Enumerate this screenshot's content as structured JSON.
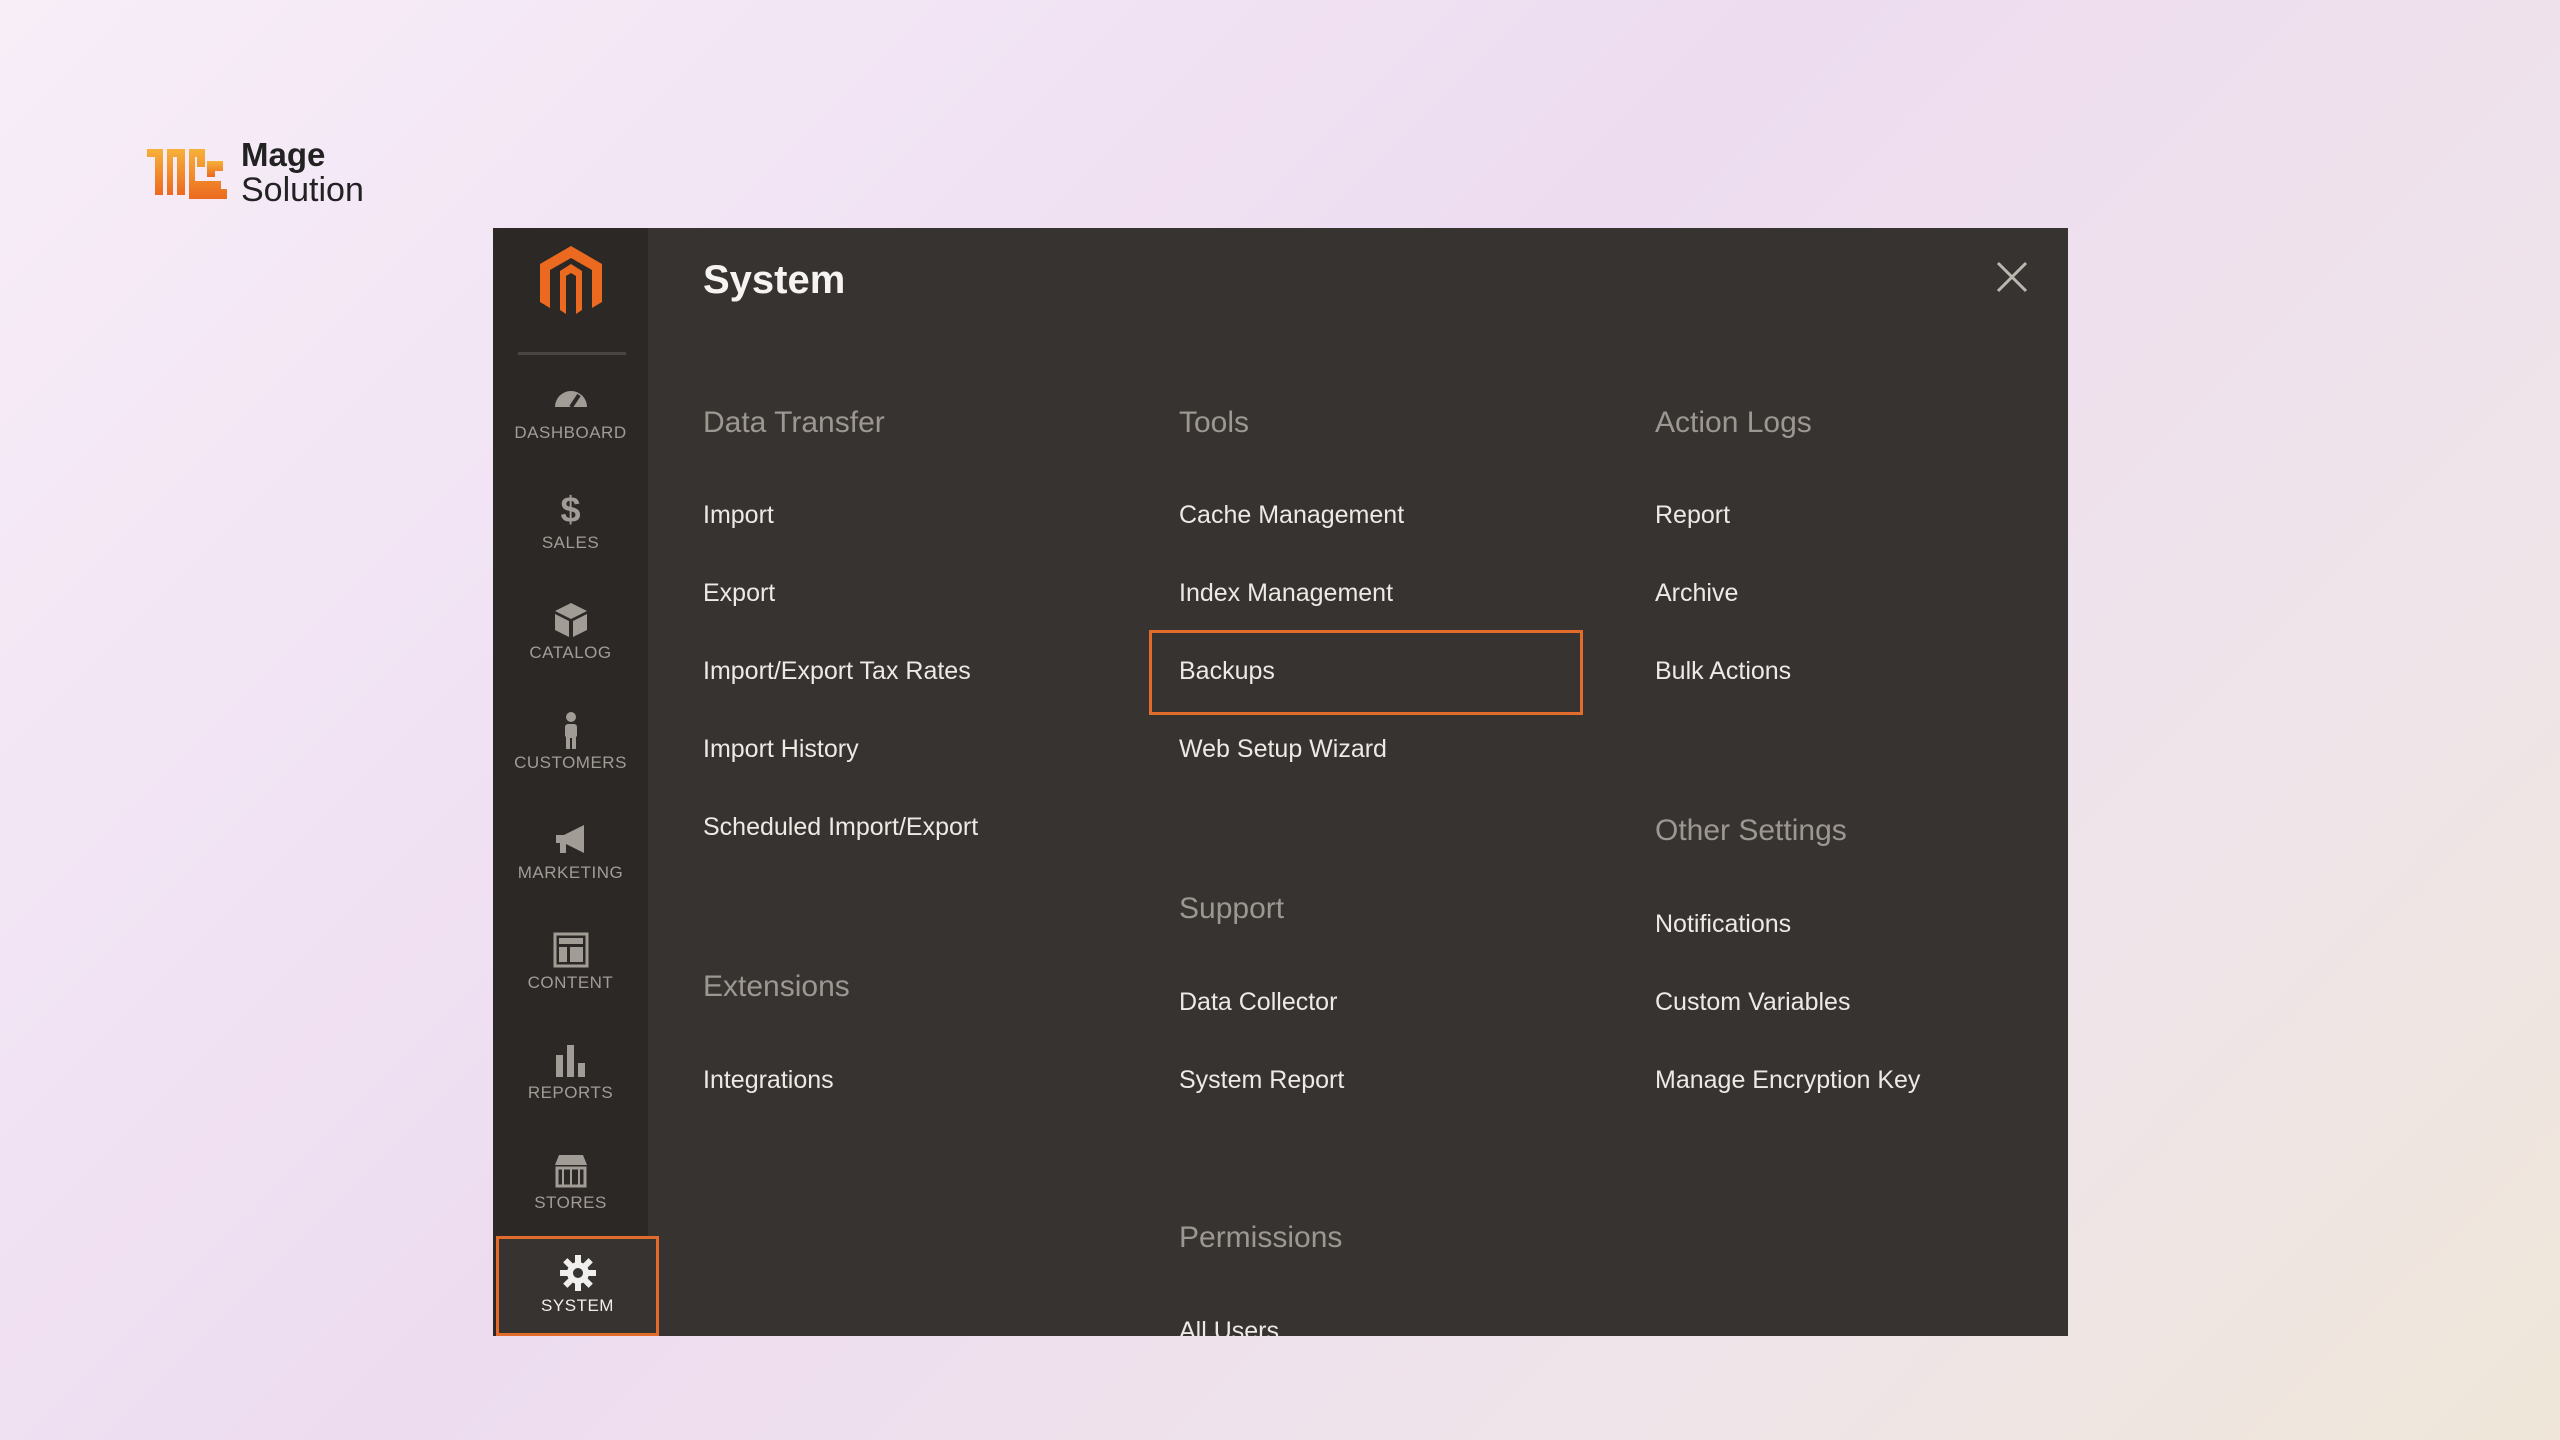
{
  "brand": {
    "line1": "Mage",
    "line2": "Solution",
    "mark_icon": "mage-solution-logo-icon",
    "color": "#f28c28"
  },
  "colors": {
    "accent": "#e26c2b",
    "panel": "#373330",
    "sidebar": "#2c2826"
  },
  "sidebar": {
    "logo_icon": "magento-logo-icon",
    "items": [
      {
        "label": "DASHBOARD",
        "icon": "speedometer-icon"
      },
      {
        "label": "SALES",
        "icon": "dollar-icon"
      },
      {
        "label": "CATALOG",
        "icon": "box-icon"
      },
      {
        "label": "CUSTOMERS",
        "icon": "person-icon"
      },
      {
        "label": "MARKETING",
        "icon": "megaphone-icon"
      },
      {
        "label": "CONTENT",
        "icon": "layout-icon"
      },
      {
        "label": "REPORTS",
        "icon": "bar-chart-icon"
      },
      {
        "label": "STORES",
        "icon": "storefront-icon"
      },
      {
        "label": "SYSTEM",
        "icon": "gear-icon",
        "active": true
      }
    ]
  },
  "panel": {
    "title": "System",
    "close_icon": "close-icon",
    "columns": [
      {
        "sections": [
          {
            "title": "Data Transfer",
            "items": [
              "Import",
              "Export",
              "Import/Export Tax Rates",
              "Import History",
              "Scheduled Import/Export"
            ]
          },
          {
            "title": "Extensions",
            "items": [
              "Integrations"
            ]
          }
        ]
      },
      {
        "sections": [
          {
            "title": "Tools",
            "items": [
              "Cache Management",
              "Index Management",
              "Backups",
              "Web Setup Wizard"
            ]
          },
          {
            "title": "Support",
            "items": [
              "Data Collector",
              "System Report"
            ]
          },
          {
            "title": "Permissions",
            "items": [
              "All Users"
            ]
          }
        ]
      },
      {
        "sections": [
          {
            "title": "Action Logs",
            "items": [
              "Report",
              "Archive",
              "Bulk Actions"
            ]
          },
          {
            "title": "Other Settings",
            "items": [
              "Notifications",
              "Custom Variables",
              "Manage Encryption Key"
            ]
          }
        ]
      }
    ],
    "highlighted_item": "Backups"
  }
}
